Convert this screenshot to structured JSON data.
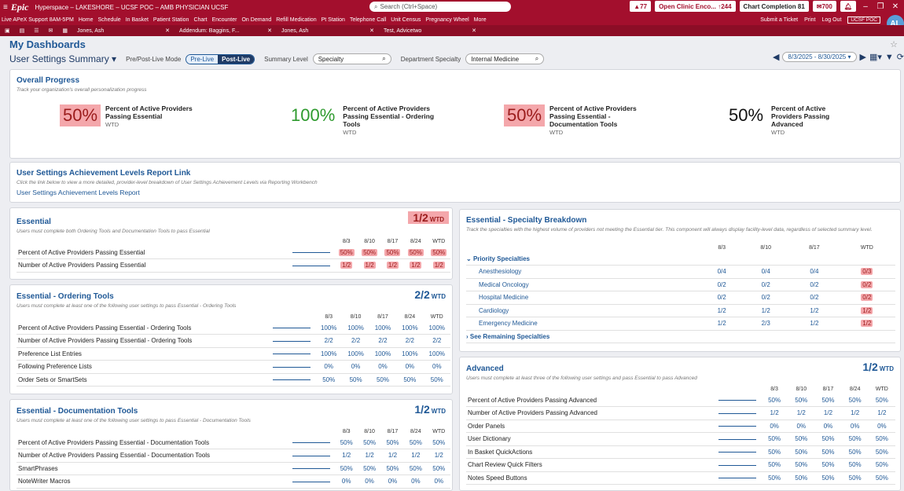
{
  "window": {
    "app": "Epic",
    "title": "Hyperspace – LAKESHORE – UCSF POC – AMB PHYSICIAN UCSF",
    "search_placeholder": "Search (Ctrl+Space)",
    "alert_count": "77",
    "open_clinic": "Open Clinic Enco... ↑244",
    "chart_completion": "Chart Completion 81",
    "inbox_count": "700"
  },
  "toolbar": {
    "items": [
      "Live APeX Support 8AM-5PM",
      "Home",
      "Schedule",
      "In Basket",
      "Patient Station",
      "Chart",
      "Encounter",
      "On Demand",
      "Refill Medication",
      "Pt Station",
      "Telephone Call",
      "Unit Census",
      "Pregnancy Wheel",
      "More"
    ],
    "right": [
      "Submit a Ticket",
      "Print",
      "Log Out"
    ],
    "org": "UCSF POC",
    "avatar": "AL"
  },
  "tabs": [
    {
      "label": "Jones, Ash"
    },
    {
      "label": "Addendum: Baggins, F..."
    },
    {
      "label": "Jones, Ash"
    },
    {
      "label": "Test, Advicetwo"
    }
  ],
  "page": {
    "title": "My Dashboards",
    "summary": "User Settings Summary",
    "mode_label": "Pre/Post-Live Mode",
    "mode_pre": "Pre-Live",
    "mode_post": "Post-Live",
    "level_label": "Summary Level",
    "level_value": "Specialty",
    "dept_label": "Department Specialty",
    "dept_value": "Internal Medicine",
    "date_range": "8/3/2025 - 8/30/2025"
  },
  "overall": {
    "title": "Overall Progress",
    "subtitle": "Track your organization's overall personalization progress",
    "metrics": [
      {
        "value": "50%",
        "label": "Percent of Active Providers Passing Essential",
        "wtd": "WTD"
      },
      {
        "value": "100%",
        "label": "Percent of Active Providers Passing Essential - Ordering Tools",
        "wtd": "WTD"
      },
      {
        "value": "50%",
        "label": "Percent of Active Providers Passing Essential - Documentation Tools",
        "wtd": "WTD"
      },
      {
        "value": "50%",
        "label": "Percent of Active Providers Passing Advanced",
        "wtd": "WTD"
      }
    ]
  },
  "report": {
    "title": "User Settings Achievement Levels Report Link",
    "subtitle": "Click the link below to view a more detailed, provider-level breakdown of User Settings Achievement Levels via Reporting Workbench",
    "link": "User Settings Achievement Levels Report"
  },
  "essential": {
    "title": "Essential",
    "subtitle": "Users must complete both Ordering Tools and Documentation Tools to pass Essential",
    "ratio": "1/2",
    "wtd": "WTD",
    "cols": [
      "8/3",
      "8/10",
      "8/17",
      "8/24",
      "WTD"
    ],
    "rows": [
      {
        "name": "Percent of Active Providers Passing Essential",
        "vals": [
          "50%",
          "50%",
          "50%",
          "50%",
          "50%"
        ]
      },
      {
        "name": "Number of Active Providers Passing Essential",
        "vals": [
          "1/2",
          "1/2",
          "1/2",
          "1/2",
          "1/2"
        ]
      }
    ]
  },
  "ordering": {
    "title": "Essential - Ordering Tools",
    "subtitle": "Users must complete at least one of the following user settings to pass Essential - Ordering Tools",
    "ratio": "2/2",
    "wtd": "WTD",
    "cols": [
      "8/3",
      "8/10",
      "8/17",
      "8/24",
      "WTD"
    ],
    "rows": [
      {
        "name": "Percent of Active Providers Passing Essential - Ordering Tools",
        "vals": [
          "100%",
          "100%",
          "100%",
          "100%",
          "100%"
        ]
      },
      {
        "name": "Number of Active Providers Passing Essential - Ordering Tools",
        "vals": [
          "2/2",
          "2/2",
          "2/2",
          "2/2",
          "2/2"
        ]
      },
      {
        "name": "Preference List Entries",
        "vals": [
          "100%",
          "100%",
          "100%",
          "100%",
          "100%"
        ]
      },
      {
        "name": "Following Preference Lists",
        "vals": [
          "0%",
          "0%",
          "0%",
          "0%",
          "0%"
        ]
      },
      {
        "name": "Order Sets or SmartSets",
        "vals": [
          "50%",
          "50%",
          "50%",
          "50%",
          "50%"
        ]
      }
    ]
  },
  "documentation": {
    "title": "Essential - Documentation Tools",
    "subtitle": "Users must complete at least one of the following user settings to pass Essential - Documentation Tools",
    "ratio": "1/2",
    "wtd": "WTD",
    "cols": [
      "8/3",
      "8/10",
      "8/17",
      "8/24",
      "WTD"
    ],
    "rows": [
      {
        "name": "Percent of Active Providers Passing Essential - Documentation Tools",
        "vals": [
          "50%",
          "50%",
          "50%",
          "50%",
          "50%"
        ]
      },
      {
        "name": "Number of Active Providers Passing Essential - Documentation Tools",
        "vals": [
          "1/2",
          "1/2",
          "1/2",
          "1/2",
          "1/2"
        ]
      },
      {
        "name": "SmartPhrases",
        "vals": [
          "50%",
          "50%",
          "50%",
          "50%",
          "50%"
        ]
      },
      {
        "name": "NoteWriter Macros",
        "vals": [
          "0%",
          "0%",
          "0%",
          "0%",
          "0%"
        ]
      }
    ]
  },
  "specialty": {
    "title": "Essential - Specialty Breakdown",
    "subtitle": "Track the specialties with the highest volume of providers not meeting the Essential tier. This component will always display facility-level data, regardless of selected summary level.",
    "cols": [
      "8/3",
      "8/10",
      "8/17",
      "WTD"
    ],
    "group": "Priority Specialties",
    "rows": [
      {
        "name": "Anesthesiology",
        "vals": [
          "0/4",
          "0/4",
          "0/4",
          "0/3"
        ]
      },
      {
        "name": "Medical Oncology",
        "vals": [
          "0/2",
          "0/2",
          "0/2",
          "0/2"
        ]
      },
      {
        "name": "Hospital Medicine",
        "vals": [
          "0/2",
          "0/2",
          "0/2",
          "0/2"
        ]
      },
      {
        "name": "Cardiology",
        "vals": [
          "1/2",
          "1/2",
          "1/2",
          "1/2"
        ]
      },
      {
        "name": "Emergency Medicine",
        "vals": [
          "1/2",
          "2/3",
          "1/2",
          "1/2"
        ]
      }
    ],
    "more": "See Remaining Specialties"
  },
  "advanced": {
    "title": "Advanced",
    "subtitle": "Users must complete at least three of the following user settings and pass Essential to pass Advanced",
    "ratio": "1/2",
    "wtd": "WTD",
    "cols": [
      "8/3",
      "8/10",
      "8/17",
      "8/24",
      "WTD"
    ],
    "rows": [
      {
        "name": "Percent of Active Providers Passing Advanced",
        "vals": [
          "50%",
          "50%",
          "50%",
          "50%",
          "50%"
        ]
      },
      {
        "name": "Number of Active Providers Passing Advanced",
        "vals": [
          "1/2",
          "1/2",
          "1/2",
          "1/2",
          "1/2"
        ]
      },
      {
        "name": "Order Panels",
        "vals": [
          "0%",
          "0%",
          "0%",
          "0%",
          "0%"
        ]
      },
      {
        "name": "User Dictionary",
        "vals": [
          "50%",
          "50%",
          "50%",
          "50%",
          "50%"
        ]
      },
      {
        "name": "In Basket QuickActions",
        "vals": [
          "50%",
          "50%",
          "50%",
          "50%",
          "50%"
        ]
      },
      {
        "name": "Chart Review Quick Filters",
        "vals": [
          "50%",
          "50%",
          "50%",
          "50%",
          "50%"
        ]
      },
      {
        "name": "Notes Speed Buttons",
        "vals": [
          "50%",
          "50%",
          "50%",
          "50%",
          "50%"
        ]
      }
    ]
  }
}
